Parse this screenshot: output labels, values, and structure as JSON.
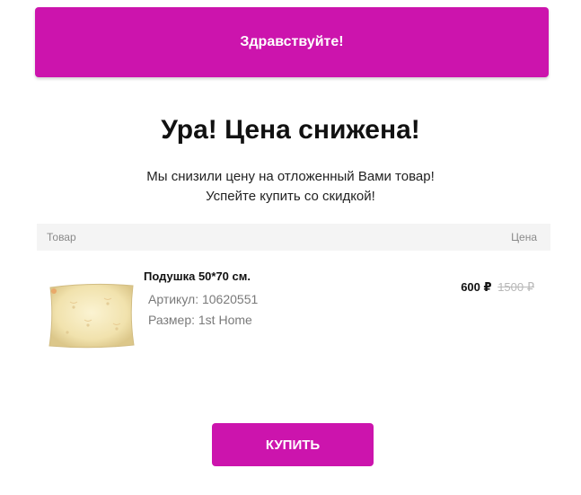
{
  "colors": {
    "accent": "#cc14ad",
    "header_bg": "#f4f4f4",
    "old_price": "#b8b8b8"
  },
  "banner": {
    "greeting": "Здравствуйте!"
  },
  "headline": "Ура! Цена снижена!",
  "subtext": {
    "line1": "Мы снизили цену на отложенный Вами товар!",
    "line2": "Успейте купить со скидкой!"
  },
  "table": {
    "columns": {
      "product": "Товар",
      "price": "Цена"
    }
  },
  "product": {
    "image_icon": "pillow-image",
    "name": "Подушка 50*70 см.",
    "sku": "Артикул: 10620551",
    "size": "Размер: 1st Home",
    "price_new": "600 ₽",
    "price_old": "1500 ₽"
  },
  "buy_button": {
    "label": "КУПИТЬ"
  }
}
